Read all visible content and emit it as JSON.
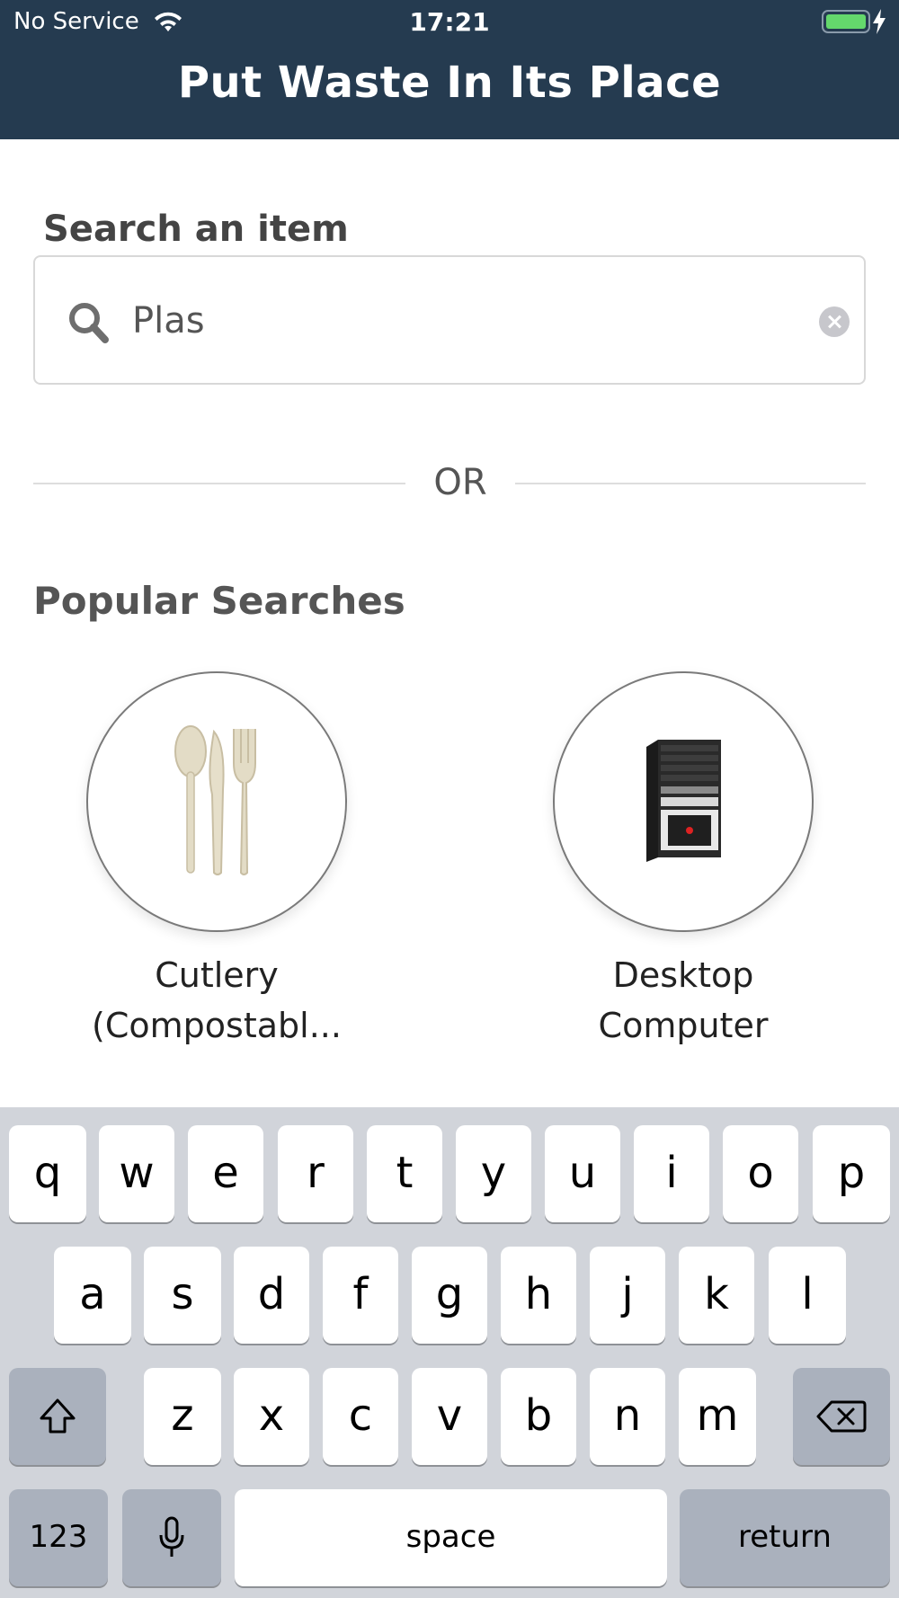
{
  "status_bar": {
    "carrier": "No Service",
    "time": "17:21"
  },
  "header": {
    "title": "Put Waste In Its Place"
  },
  "search": {
    "label": "Search an item",
    "value": "Plas"
  },
  "divider": {
    "text": "OR"
  },
  "popular": {
    "title": "Popular Searches",
    "items": [
      {
        "label_line1": "Cutlery",
        "label_line2": "(Compostabl..."
      },
      {
        "label_line1": "Desktop",
        "label_line2": "Computer"
      }
    ]
  },
  "keyboard": {
    "row1": [
      "q",
      "w",
      "e",
      "r",
      "t",
      "y",
      "u",
      "i",
      "o",
      "p"
    ],
    "row2": [
      "a",
      "s",
      "d",
      "f",
      "g",
      "h",
      "j",
      "k",
      "l"
    ],
    "row3": [
      "z",
      "x",
      "c",
      "v",
      "b",
      "n",
      "m"
    ],
    "numbers_label": "123",
    "space_label": "space",
    "return_label": "return"
  },
  "colors": {
    "header_bg": "#253b50",
    "battery_fill": "#64d86c",
    "keyboard_bg": "#d1d4da"
  }
}
